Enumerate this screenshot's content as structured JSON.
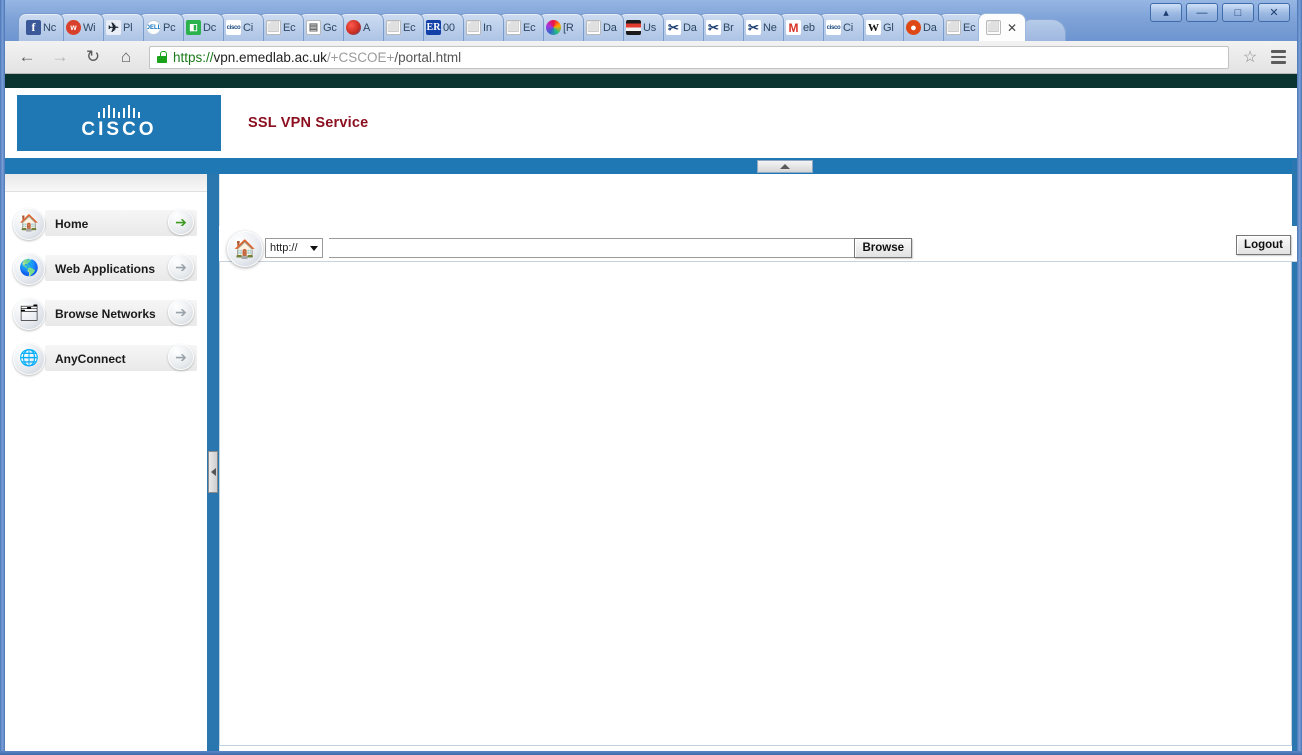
{
  "browser": {
    "tabs": [
      {
        "label": "Nc",
        "icon": "facebook-icon",
        "icon_class": "fi-fb",
        "glyph": "f"
      },
      {
        "label": "Wi",
        "icon": "wordpress-icon",
        "icon_class": "fi-wp",
        "glyph": "w"
      },
      {
        "label": "Pl",
        "icon": "plane-icon",
        "icon_class": "fi-pl",
        "glyph": "✈"
      },
      {
        "label": "Pc",
        "icon": "dell-icon",
        "icon_class": "fi-pc",
        "glyph": "DELL"
      },
      {
        "label": "Dc",
        "icon": "green-doc-icon",
        "icon_class": "fi-gr",
        "glyph": "◧"
      },
      {
        "label": "Ci",
        "icon": "cisco-icon",
        "icon_class": "fi-cisco",
        "glyph": "cisco"
      },
      {
        "label": "Ec",
        "icon": "page-icon",
        "icon_class": "fi-doc",
        "glyph": "⬜"
      },
      {
        "label": "Gc",
        "icon": "form-icon",
        "icon_class": "fi-doc",
        "glyph": "▤"
      },
      {
        "label": "A",
        "icon": "art-icon",
        "icon_class": "fi-art",
        "glyph": ""
      },
      {
        "label": "Ec",
        "icon": "page-icon",
        "icon_class": "fi-doc",
        "glyph": "⬜"
      },
      {
        "label": "00",
        "icon": "er-icon",
        "icon_class": "fi-er",
        "glyph": "ER"
      },
      {
        "label": "In",
        "icon": "page-icon",
        "icon_class": "fi-doc",
        "glyph": "⬜"
      },
      {
        "label": "Ec",
        "icon": "page-icon",
        "icon_class": "fi-doc",
        "glyph": "⬜"
      },
      {
        "label": "[R",
        "icon": "palette-icon",
        "icon_class": "fi-rgb",
        "glyph": ""
      },
      {
        "label": "Da",
        "icon": "page-icon",
        "icon_class": "fi-doc",
        "glyph": "⬜"
      },
      {
        "label": "Us",
        "icon": "stripes-icon",
        "icon_class": "fi-us",
        "glyph": ""
      },
      {
        "label": "Da",
        "icon": "scissors-icon",
        "icon_class": "fi-x",
        "glyph": "✂"
      },
      {
        "label": "Br",
        "icon": "scissors-icon",
        "icon_class": "fi-x",
        "glyph": "✂"
      },
      {
        "label": "Ne",
        "icon": "scissors-icon",
        "icon_class": "fi-x",
        "glyph": "✂"
      },
      {
        "label": "eb",
        "icon": "gmail-icon",
        "icon_class": "fi-gm",
        "glyph": "M"
      },
      {
        "label": "Ci",
        "icon": "cisco-icon",
        "icon_class": "fi-cisco",
        "glyph": "cisco"
      },
      {
        "label": "Gl",
        "icon": "wikipedia-icon",
        "icon_class": "fi-w",
        "glyph": "W"
      },
      {
        "label": "Da",
        "icon": "ubuntu-icon",
        "icon_class": "fi-ub",
        "glyph": "●"
      },
      {
        "label": "Ec",
        "icon": "page-icon",
        "icon_class": "fi-doc",
        "glyph": "⬜"
      },
      {
        "label": "",
        "icon": "page-icon",
        "icon_class": "fi-doc",
        "glyph": "⬜",
        "active": true,
        "close": "✕"
      }
    ],
    "window_buttons": [
      {
        "name": "account-button",
        "glyph": "▴"
      },
      {
        "name": "minimize-button",
        "glyph": "—"
      },
      {
        "name": "maximize-button",
        "glyph": "□"
      },
      {
        "name": "close-button",
        "glyph": "✕"
      }
    ],
    "nav": {
      "back": "←",
      "forward": "→",
      "reload": "↻",
      "home": "⌂",
      "bookmark_star": "☆"
    },
    "url": {
      "scheme": "https://",
      "host": "vpn.emedlab.ac.uk",
      "dim_segment": "/+CSCOE+",
      "path": "/portal.html",
      "full": "https://vpn.emedlab.ac.uk/+CSCOE+/portal.html"
    }
  },
  "page": {
    "brand": {
      "logo_word": "CISCO",
      "service_title": "SSL VPN Service"
    },
    "toolbar": {
      "home_icon": "🏠",
      "protocol_value": "http://",
      "address_value": "",
      "browse_label": "Browse",
      "logout_label": "Logout",
      "collapse_up_icon": "collapse-up-icon"
    },
    "sidebar": {
      "collapse_icon": "collapse-left-icon",
      "items": [
        {
          "label": "Home",
          "icon": "home-icon",
          "glyph": "🏠",
          "arrow": "➔",
          "active": true
        },
        {
          "label": "Web Applications",
          "icon": "globe-icon",
          "glyph": "🌎",
          "arrow": "➔",
          "active": false
        },
        {
          "label": "Browse Networks",
          "icon": "network-icon",
          "glyph": "🗂",
          "arrow": "➔",
          "active": false
        },
        {
          "label": "AnyConnect",
          "icon": "anyconnect-icon",
          "glyph": "🌐",
          "arrow": "➔",
          "active": false
        }
      ]
    },
    "colors": {
      "cisco_blue": "#1f78b4",
      "splitter_blue": "#2a77b0",
      "title_red": "#8b0f1e",
      "top_band": "#0b3431"
    }
  }
}
